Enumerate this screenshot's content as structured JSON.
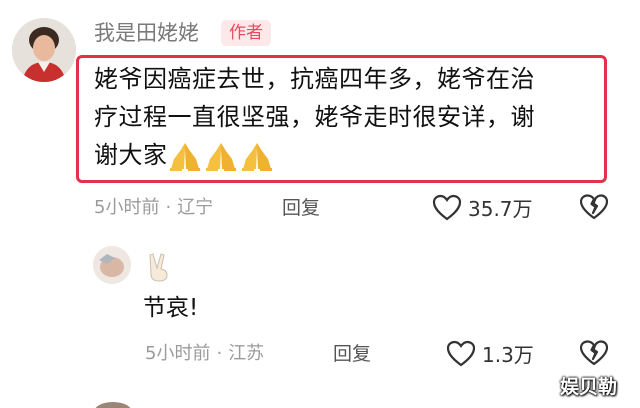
{
  "comment": {
    "author_name": "我是田姥姥",
    "author_badge": "作者",
    "text_line1": "姥爷因癌症去世，抗癌四年多，姥爷在治",
    "text_line2": "疗过程一直很坚强，姥爷走时很安详，谢",
    "text_line3": "谢大家",
    "emoji": "folded-hands",
    "time": "5小时前",
    "location": "辽宁",
    "reply_label": "回复",
    "like_count": "35.7万"
  },
  "reply": {
    "emoji": "victory-hand",
    "text": "节哀!",
    "time": "5小时前",
    "location": "江苏",
    "reply_label": "回复",
    "like_count": "1.3万"
  },
  "watermark": "娱贝勒",
  "colors": {
    "highlight": "#e3314a",
    "badge_bg": "#fde8ea",
    "badge_text": "#e84a5f"
  }
}
